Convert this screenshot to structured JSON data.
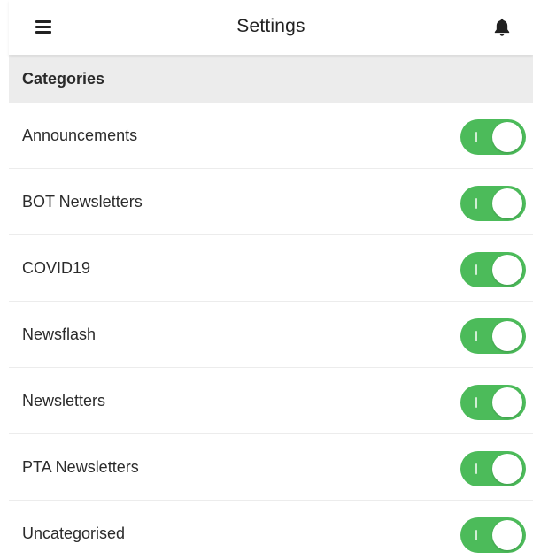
{
  "header": {
    "title": "Settings",
    "menu_icon": "hamburger-menu-icon",
    "notification_icon": "bell-icon"
  },
  "section": {
    "title": "Categories"
  },
  "categories": [
    {
      "label": "Announcements",
      "enabled": true
    },
    {
      "label": "BOT Newsletters",
      "enabled": true
    },
    {
      "label": "COVID19",
      "enabled": true
    },
    {
      "label": "Newsflash",
      "enabled": true
    },
    {
      "label": "Newsletters",
      "enabled": true
    },
    {
      "label": "PTA Newsletters",
      "enabled": true
    },
    {
      "label": "Uncategorised",
      "enabled": true
    }
  ],
  "colors": {
    "toggle_on": "#4cbb5a",
    "section_background": "#ececec",
    "text": "#2b2b2b"
  }
}
